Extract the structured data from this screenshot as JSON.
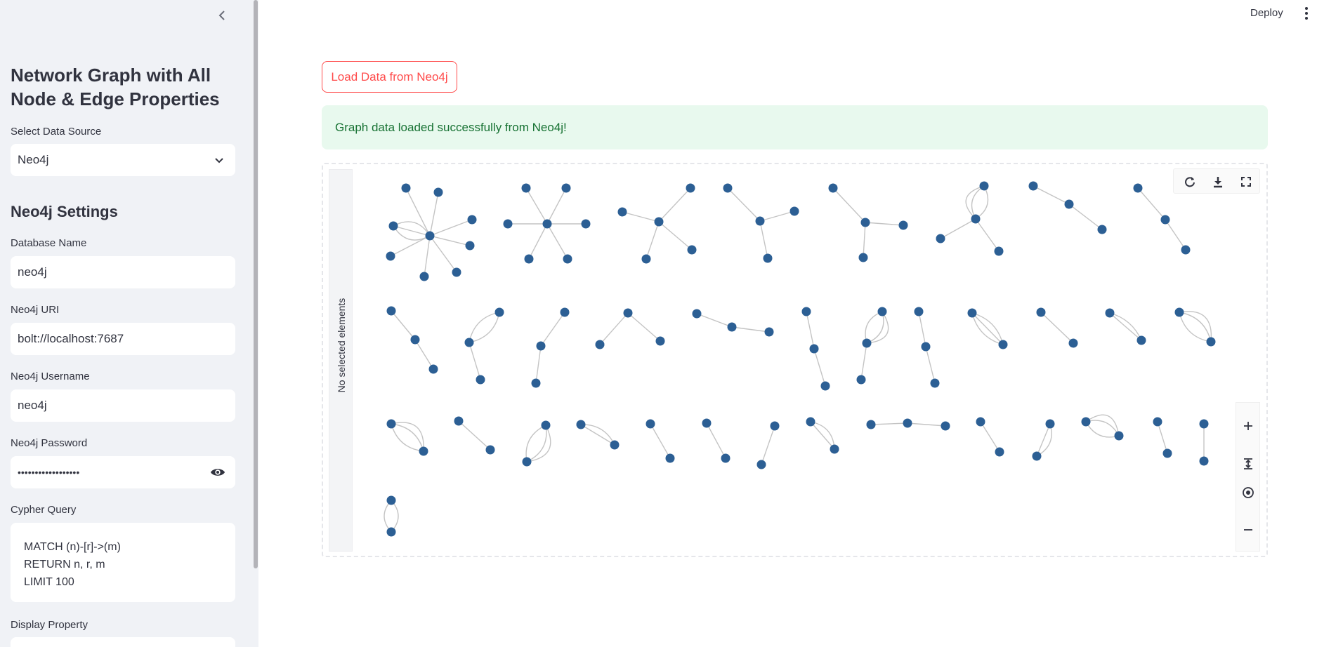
{
  "sidebar": {
    "title": "Network Graph with All Node & Edge Properties",
    "data_source": {
      "label": "Select Data Source",
      "value": "Neo4j"
    },
    "settings_heading": "Neo4j Settings",
    "database_name": {
      "label": "Database Name",
      "value": "neo4j"
    },
    "uri": {
      "label": "Neo4j URI",
      "value": "bolt://localhost:7687"
    },
    "username": {
      "label": "Neo4j Username",
      "value": "neo4j"
    },
    "password": {
      "label": "Neo4j Password",
      "value": "••••••••••••••••••"
    },
    "cypher": {
      "label": "Cypher Query",
      "value": "MATCH (n)-[r]->(m)\nRETURN n, r, m\nLIMIT 100"
    },
    "display_property": {
      "label": "Display Property"
    }
  },
  "header": {
    "deploy": "Deploy"
  },
  "main": {
    "load_button": "Load Data from Neo4j",
    "success_message": "Graph data loaded successfully from Neo4j!",
    "side_panel": "No selected elements"
  },
  "colors": {
    "node": "#2c5f94",
    "edge": "#c4c4c4",
    "accent": "#ff4b4b",
    "success_bg": "#e8f9ee",
    "success_text": "#177233"
  },
  "icons": [
    "chevron-left-icon",
    "chevron-down-icon",
    "eye-icon",
    "kebab-menu-icon",
    "refresh-icon",
    "download-icon",
    "fullscreen-icon",
    "zoom-in-icon",
    "fit-icon",
    "center-icon",
    "zoom-out-icon"
  ]
}
